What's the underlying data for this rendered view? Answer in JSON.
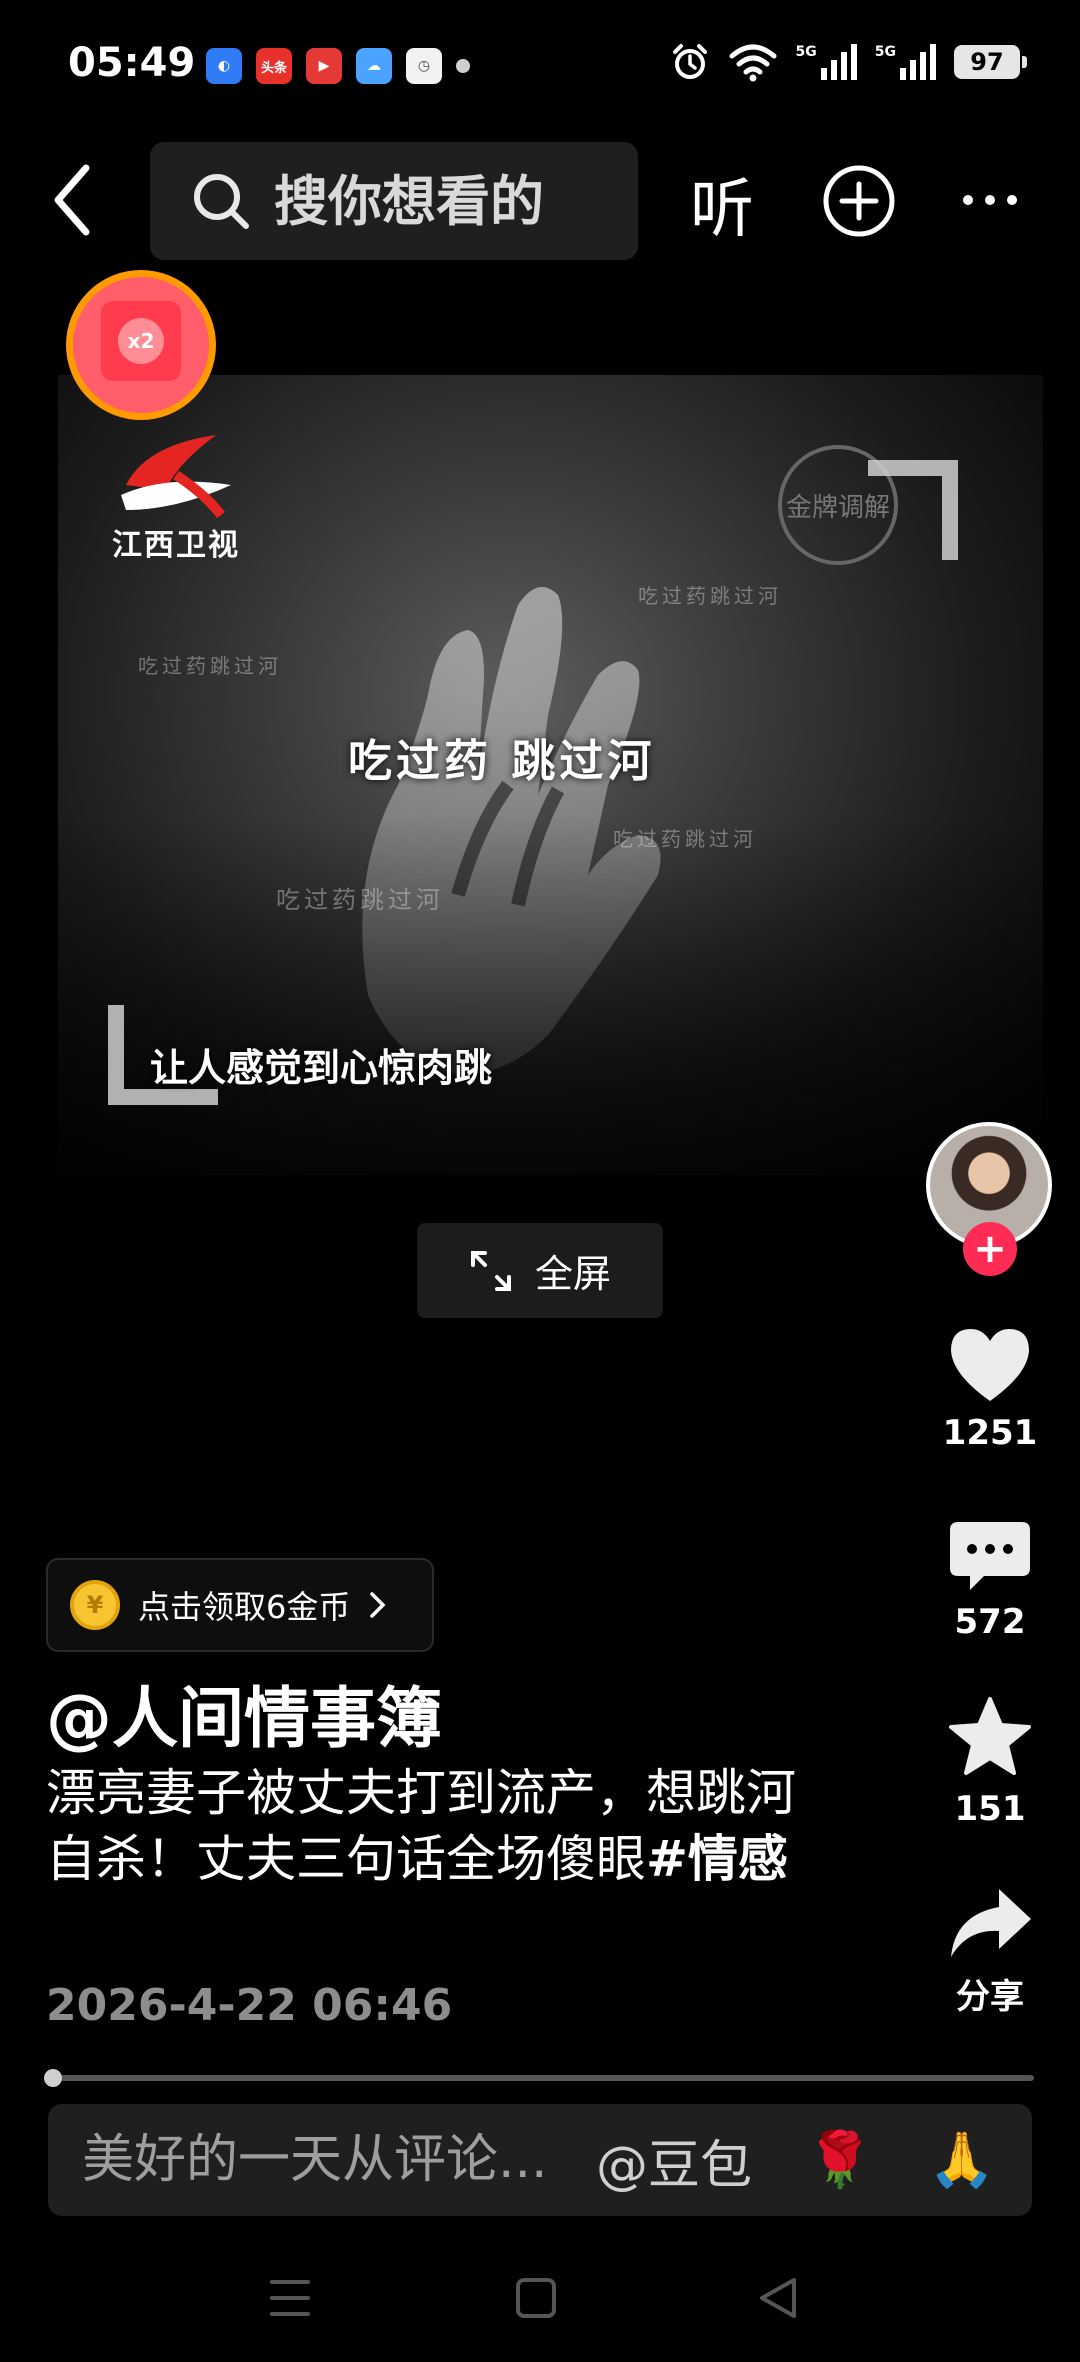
{
  "status_bar": {
    "time": "05:49",
    "battery": "97",
    "notification_apps": [
      "browser-app-icon",
      "toutiao-app-icon",
      "video-app-icon",
      "weather-app-icon",
      "calendar-app-icon"
    ],
    "toutiao_label": "头条",
    "signal_labels": [
      "5G",
      "5G"
    ]
  },
  "top_nav": {
    "search_placeholder": "搜你想看的",
    "listen_label": "听"
  },
  "red_packet": {
    "multiplier": "x2"
  },
  "video": {
    "channel_name": "江西卫视",
    "stamp_text": "金牌调解",
    "subtitle_main": "吃过药  跳过河",
    "subtitle_bottom": "让人感觉到心惊肉跳",
    "ghost_texts": [
      "吃过药跳过河",
      "吃过药跳过河",
      "吃过药跳过河",
      "吃过药跳过河"
    ]
  },
  "fullscreen_label": "全屏",
  "actions": {
    "like_count": "1251",
    "comment_count": "572",
    "favorite_count": "151",
    "share_label": "分享"
  },
  "coin_task": {
    "label": "点击领取6金币",
    "coin_symbol": "¥"
  },
  "post": {
    "author": "@人间情事簿",
    "caption": "漂亮妻子被丈夫打到流产，想跳河自杀！丈夫三句话全场傻眼",
    "hashtag": "#情感",
    "published": "2026-4-22 06:46"
  },
  "comment_bar": {
    "placeholder": "美好的一天从评论...",
    "mention": "@豆包",
    "emojis": [
      "🌹",
      "🙏"
    ]
  },
  "colors": {
    "accent_red": "#fe2c55",
    "red_packet_ring": "#ff9a00",
    "coin_gold": "#f6c531"
  }
}
